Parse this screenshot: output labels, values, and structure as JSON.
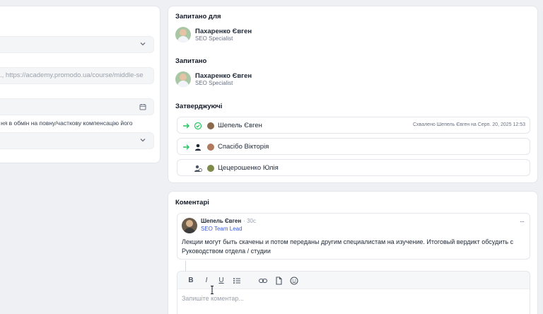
{
  "left_panel": {
    "url_placeholder": "., https://academy.promodo.ua/course/middle-se",
    "compensation_note": "ня в обмін на повну/часткову компенсацію його"
  },
  "requested_for": {
    "title": "Запитано для",
    "name": "Пахаренко Євген",
    "role": "SEO Specialist"
  },
  "requested_by": {
    "title": "Запитано",
    "name": "Пахаренко Євген",
    "role": "SEO Specialist"
  },
  "approvers": {
    "title": "Затверджуючі",
    "items": [
      {
        "name": "Шепель Євген",
        "status": "Схвалено Шепель Євген на Серп. 20, 2025 12:53"
      },
      {
        "name": "Спасібо Вікторія",
        "status": ""
      },
      {
        "name": "Цецерошенко Юлія",
        "status": ""
      }
    ]
  },
  "comments": {
    "title": "Коментарі",
    "items": [
      {
        "author": "Шепель Євген",
        "time": "· 30с",
        "role": "SEO Team Lead",
        "body": "Лекции могут быть скачены и потом переданы другим специалистам на изучение. Итоговый вердикт обсудить с Руководством отдела / студии"
      }
    ],
    "more": "···"
  },
  "editor": {
    "bold": "B",
    "italic": "I",
    "underline": "U",
    "placeholder": "Запишіте коментар..."
  },
  "colors": {
    "accent_green": "#22c55e",
    "role_blue": "#3b5bdb"
  }
}
